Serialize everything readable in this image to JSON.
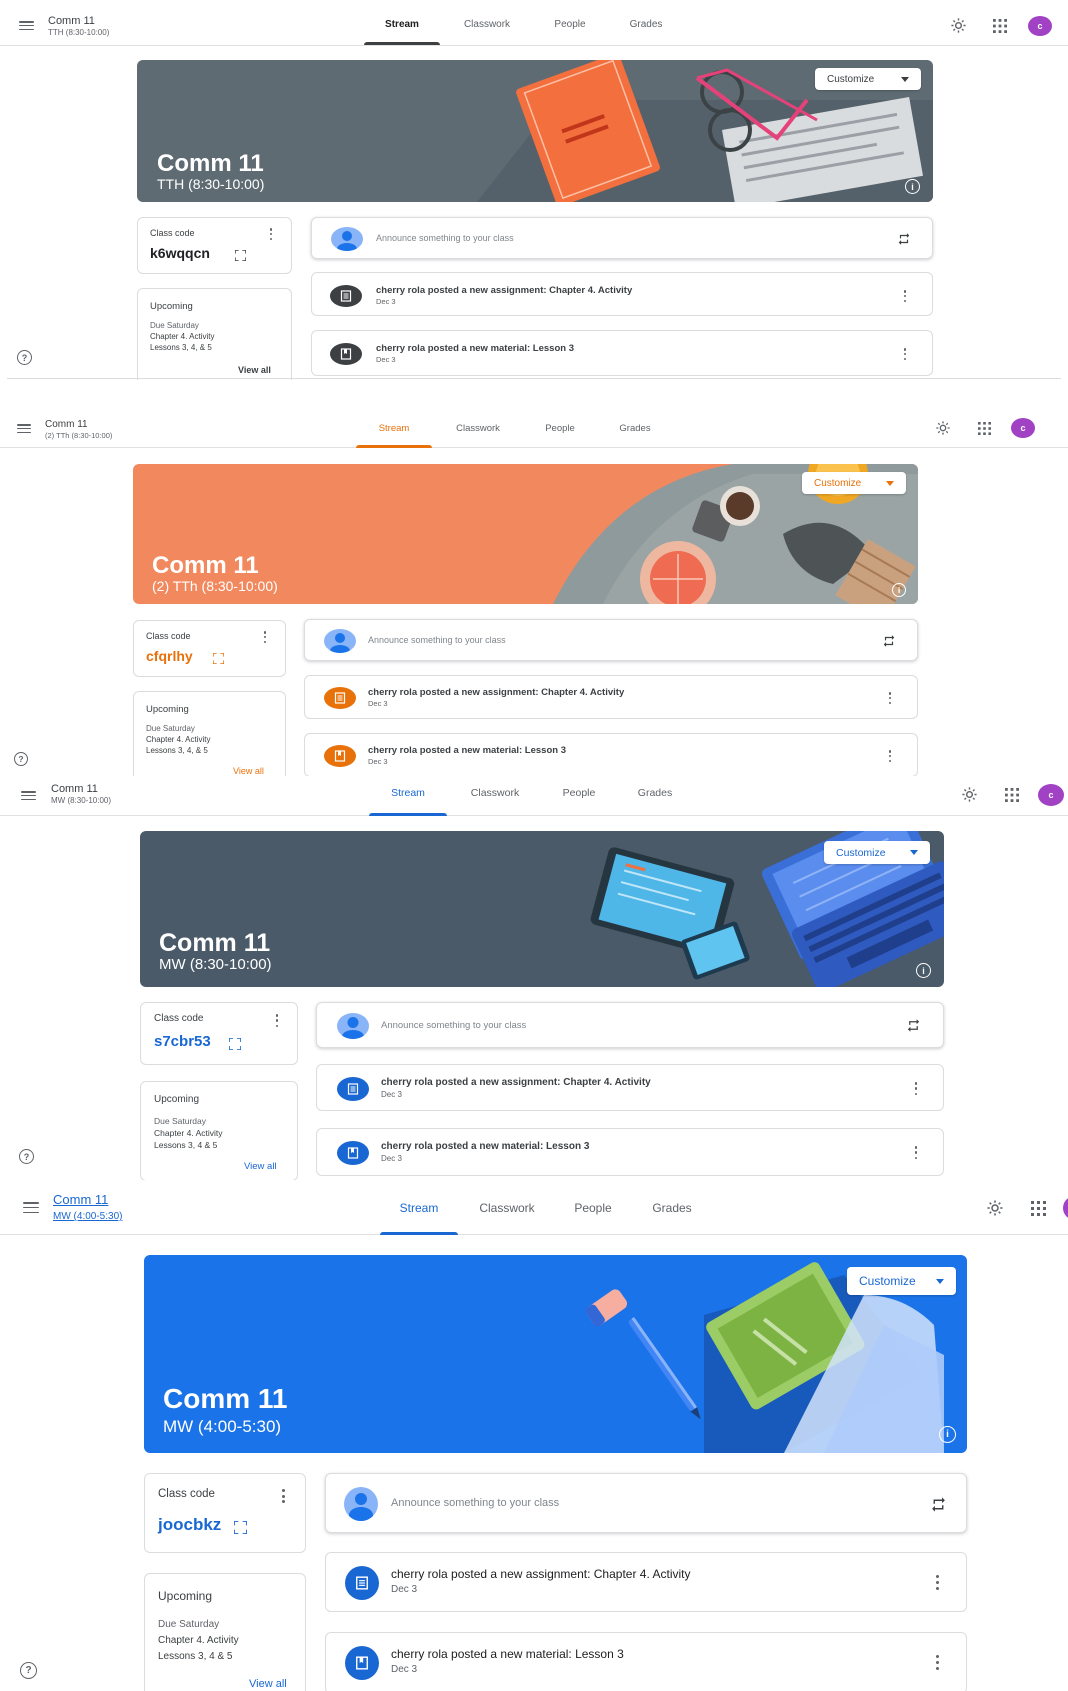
{
  "tabs": [
    "Stream",
    "Classwork",
    "People",
    "Grades"
  ],
  "avatar_initial": "c",
  "customize_label": "Customize",
  "class_code_label": "Class code",
  "announce_placeholder": "Announce something to your class",
  "upcoming_label": "Upcoming",
  "view_all_label": "View all",
  "posts": {
    "assignment": "cherry rola posted a new assignment: Chapter 4. Activity",
    "material": "cherry rola posted a new material: Lesson 3",
    "date": "Dec 3"
  },
  "panels": [
    {
      "header_title": "Comm 11",
      "header_sub": "TTH (8:30-10:00)",
      "banner_title": "Comm 11",
      "banner_sub": "TTH (8:30-10:00)",
      "class_code": "k6wqqcn",
      "upcoming_lines": [
        "Due Saturday",
        "Chapter 4. Activity",
        "Lessons 3, 4, & 5"
      ],
      "theme": {
        "banner": "#5f6b73",
        "accent": "#3c4043",
        "post_icon": "#3c4043"
      }
    },
    {
      "header_title": "Comm 11",
      "header_sub": "(2) TTh (8:30-10:00)",
      "banner_title": "Comm 11",
      "banner_sub": "(2) TTh (8:30-10:00)",
      "class_code": "cfqrlhy",
      "upcoming_lines": [
        "Due Saturday",
        "Chapter 4. Activity",
        "Lessons 3, 4, & 5"
      ],
      "theme": {
        "banner": "#f2895e",
        "accent": "#e8710a",
        "post_icon": "#e8710a"
      }
    },
    {
      "header_title": "Comm 11",
      "header_sub": "MW (8:30-10:00)",
      "banner_title": "Comm 11",
      "banner_sub": "MW (8:30-10:00)",
      "class_code": "s7cbr53",
      "upcoming_lines": [
        "Due Saturday",
        "Chapter 4. Activity",
        "Lessons 3, 4 & 5"
      ],
      "theme": {
        "banner": "#4a5a68",
        "accent": "#1967d2",
        "post_icon": "#1967d2"
      }
    },
    {
      "header_title": "Comm 11",
      "header_sub": "MW (4:00-5:30)",
      "banner_title": "Comm 11",
      "banner_sub": "MW (4:00-5:30)",
      "class_code": "joocbkz",
      "upcoming_lines": [
        "Due Saturday",
        "Chapter 4. Activity",
        "Lessons 3, 4 & 5"
      ],
      "theme": {
        "banner": "#1a73e8",
        "accent": "#1967d2",
        "post_icon": "#1967d2"
      }
    }
  ]
}
